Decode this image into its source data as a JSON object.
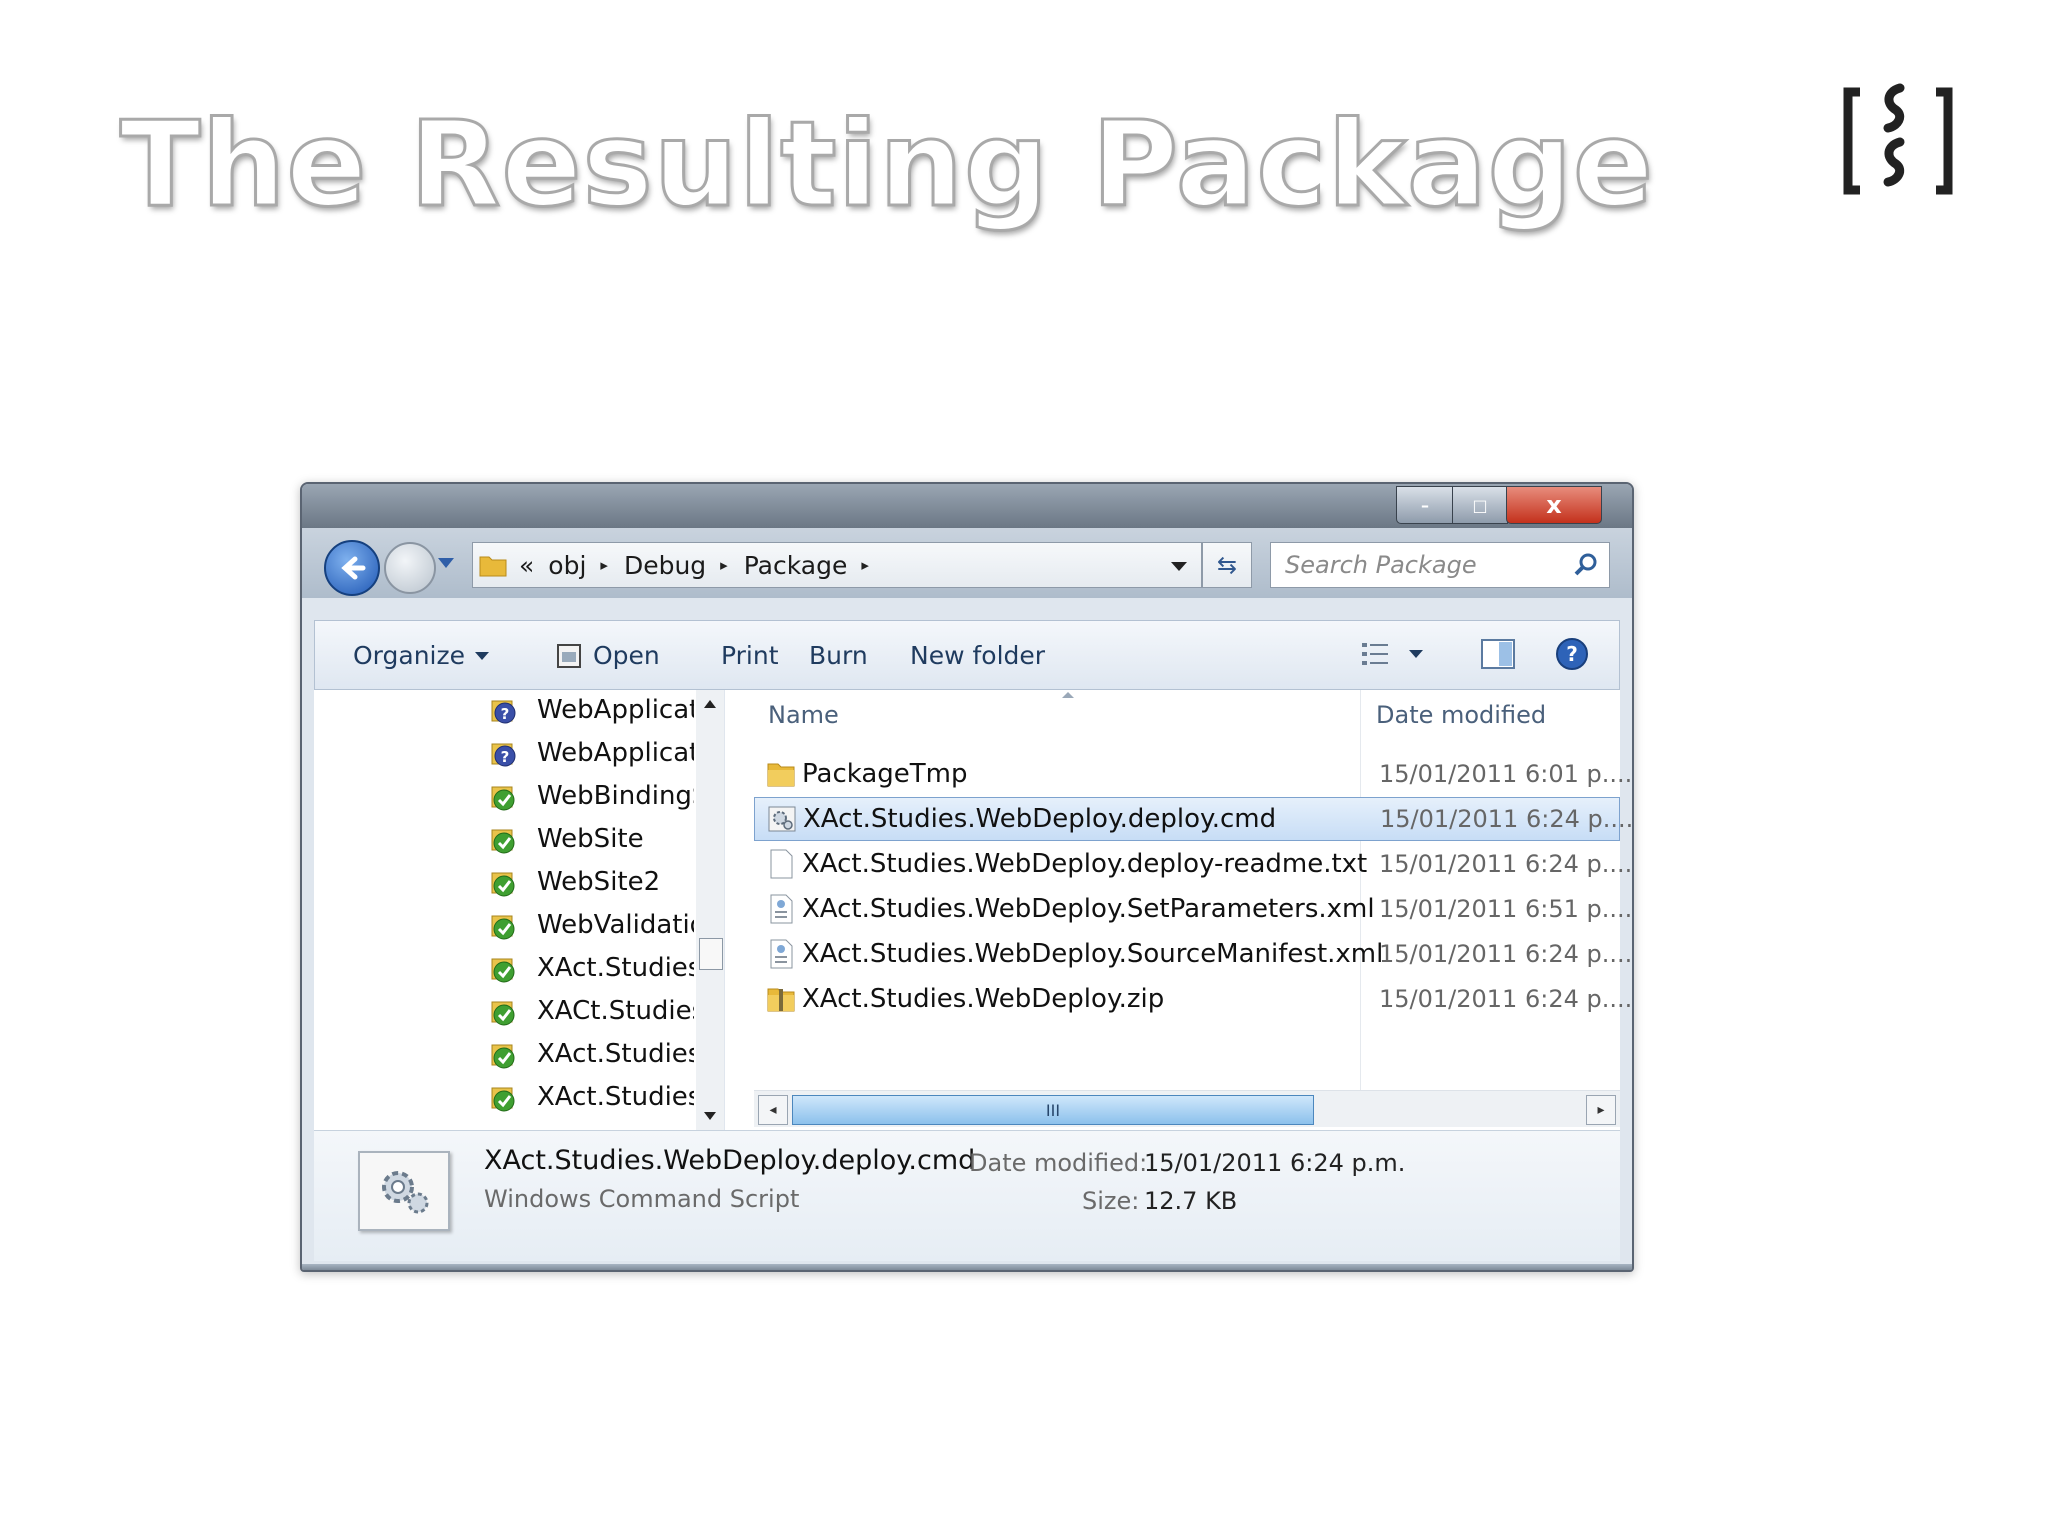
{
  "slide": {
    "title": "The Resulting Package"
  },
  "window": {
    "controls": {
      "minimize": "–",
      "maximize": "□",
      "close": "x"
    },
    "address": {
      "overflow": "«",
      "crumbs": [
        "obj",
        "Debug",
        "Package"
      ],
      "separator": "▸"
    },
    "search": {
      "placeholder": "Search Package"
    },
    "toolbar": {
      "organize": "Organize",
      "open": "Open",
      "print": "Print",
      "burn": "Burn",
      "new_folder": "New folder"
    },
    "nav_pane": {
      "items": [
        {
          "label": "WebApplication",
          "icon": "project-question-icon"
        },
        {
          "label": "WebApplication",
          "icon": "project-question-icon"
        },
        {
          "label": "WebBindingStu",
          "icon": "project-check-icon"
        },
        {
          "label": "WebSite",
          "icon": "project-check-icon"
        },
        {
          "label": "WebSite2",
          "icon": "project-check-icon"
        },
        {
          "label": "WebValidationT",
          "icon": "project-check-icon"
        },
        {
          "label": "XAct.Studies.Bl",
          "icon": "project-check-icon"
        },
        {
          "label": "XACt.Studies.C",
          "icon": "project-check-icon"
        },
        {
          "label": "XAct.Studies.JQ",
          "icon": "project-check-icon"
        },
        {
          "label": "XAct.Studies.Lo",
          "icon": "project-check-icon"
        }
      ]
    },
    "file_list": {
      "columns": {
        "name": "Name",
        "date": "Date modified"
      },
      "rows": [
        {
          "name": "PackageTmp",
          "date": "15/01/2011 6:01 p....",
          "icon": "folder-icon",
          "selected": false
        },
        {
          "name": "XAct.Studies.WebDeploy.deploy.cmd",
          "date": "15/01/2011 6:24 p....",
          "icon": "cmd-script-icon",
          "selected": true
        },
        {
          "name": "XAct.Studies.WebDeploy.deploy-readme.txt",
          "date": "15/01/2011 6:24 p....",
          "icon": "text-file-icon",
          "selected": false
        },
        {
          "name": "XAct.Studies.WebDeploy.SetParameters.xml",
          "date": "15/01/2011 6:51 p....",
          "icon": "xml-file-icon",
          "selected": false
        },
        {
          "name": "XAct.Studies.WebDeploy.SourceManifest.xml",
          "date": "15/01/2011 6:24 p....",
          "icon": "xml-file-icon",
          "selected": false
        },
        {
          "name": "XAct.Studies.WebDeploy.zip",
          "date": "15/01/2011 6:24 p....",
          "icon": "zip-folder-icon",
          "selected": false
        }
      ],
      "hscroll_grip": "III"
    },
    "details": {
      "name": "XAct.Studies.WebDeploy.deploy.cmd",
      "type": "Windows Command Script",
      "date_label": "Date modified:",
      "date_value": "15/01/2011 6:24 p.m.",
      "size_label": "Size:",
      "size_value": "12.7 KB"
    }
  }
}
